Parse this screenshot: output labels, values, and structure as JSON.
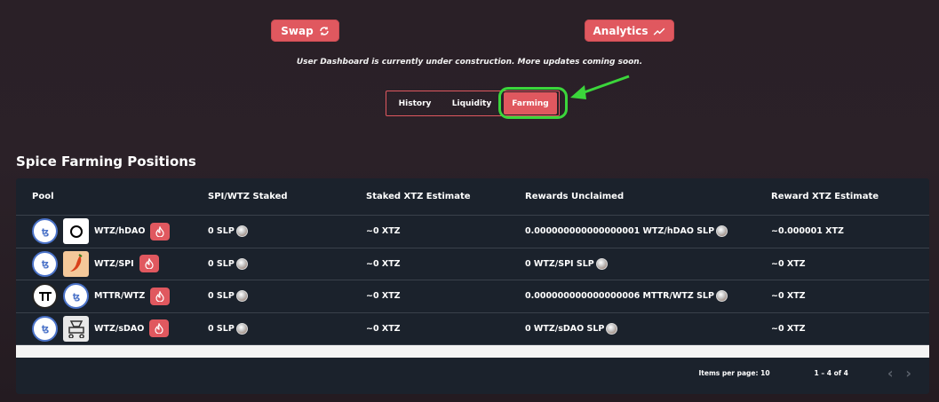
{
  "top_buttons": {
    "swap": "Swap",
    "analytics": "Analytics"
  },
  "notice": "User Dashboard is currently under construction. More updates coming soon.",
  "tabs": [
    "History",
    "Liquidity",
    "Farming"
  ],
  "active_tab": "Farming",
  "section_title": "Spice Farming Positions",
  "table": {
    "headers": [
      "Pool",
      "SPI/WTZ Staked",
      "Staked XTZ Estimate",
      "Rewards Unclaimed",
      "Reward XTZ Estimate"
    ],
    "rows": [
      {
        "pool": "WTZ/hDAO",
        "staked": "0 SLP",
        "estimate": "~0 XTZ",
        "rewards": "0.000000000000000001 WTZ/hDAO SLP",
        "reward_est": "~0.000001 XTZ"
      },
      {
        "pool": "WTZ/SPI",
        "staked": "0 SLP",
        "estimate": "~0 XTZ",
        "rewards": "0 WTZ/SPI SLP",
        "reward_est": "~0 XTZ"
      },
      {
        "pool": "MTTR/WTZ",
        "staked": "0 SLP",
        "estimate": "~0 XTZ",
        "rewards": "0.000000000000000006 MTTR/WTZ SLP",
        "reward_est": "~0 XTZ"
      },
      {
        "pool": "WTZ/sDAO",
        "staked": "0 SLP",
        "estimate": "~0 XTZ",
        "rewards": "0 WTZ/sDAO SLP",
        "reward_est": "~0 XTZ"
      }
    ]
  },
  "pagination": {
    "items_per_page": "Items per page: 10",
    "range": "1 – 4 of 4"
  },
  "colors": {
    "accent": "#e0585f",
    "highlight": "#3bd63b",
    "card": "#1b222c"
  }
}
